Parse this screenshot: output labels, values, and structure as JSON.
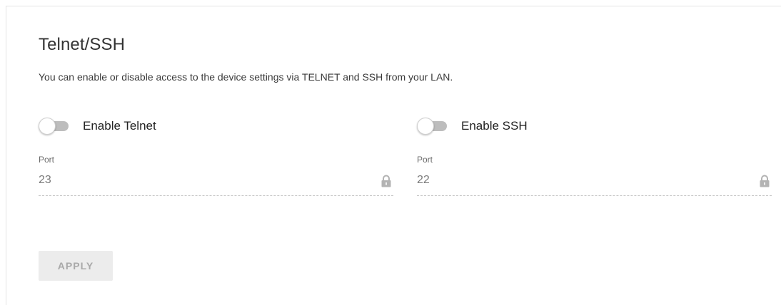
{
  "section": {
    "title": "Telnet/SSH",
    "description": "You can enable or disable access to the device settings via TELNET and SSH from your LAN."
  },
  "telnet": {
    "toggle_label": "Enable Telnet",
    "enabled": false,
    "port_label": "Port",
    "port_value": "23",
    "locked": true
  },
  "ssh": {
    "toggle_label": "Enable SSH",
    "enabled": false,
    "port_label": "Port",
    "port_value": "22",
    "locked": true
  },
  "actions": {
    "apply_label": "APPLY"
  },
  "icons": {
    "lock": "lock-icon"
  },
  "colors": {
    "toggle_off_track": "#bdbdbd",
    "disabled_button_bg": "#ececec",
    "disabled_button_text": "#a9a9a9",
    "lock_icon": "#b3b3b3"
  }
}
